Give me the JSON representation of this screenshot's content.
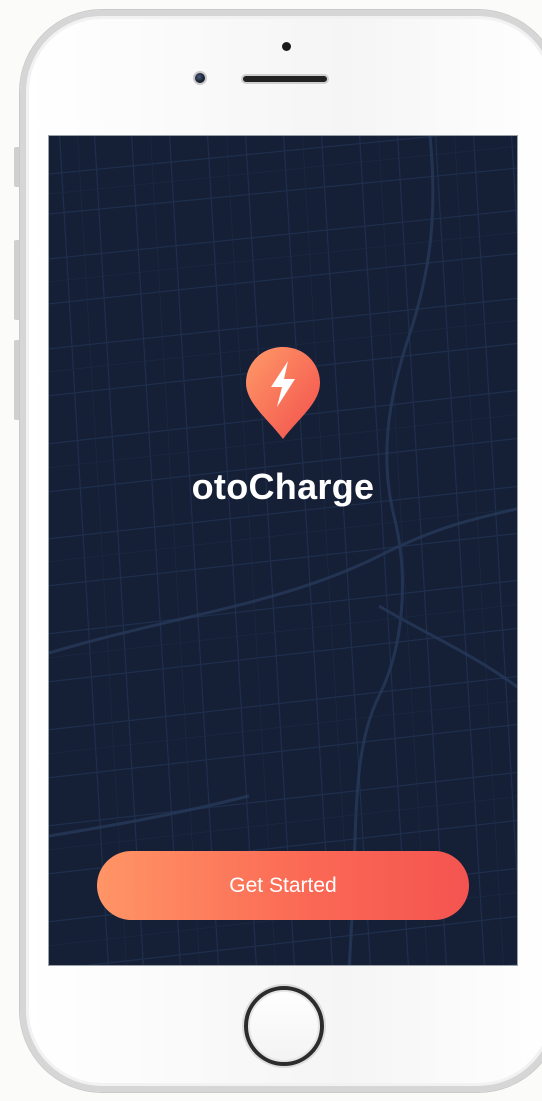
{
  "app": {
    "name": "otoCharge"
  },
  "cta": {
    "label": "Get Started"
  },
  "icons": {
    "logo": "map-pin-lightning-icon"
  },
  "colors": {
    "screen_background": "#152036",
    "map_streets": "#233150",
    "accent_start": "#ff9566",
    "accent_end": "#f45450",
    "text": "#ffffff"
  }
}
